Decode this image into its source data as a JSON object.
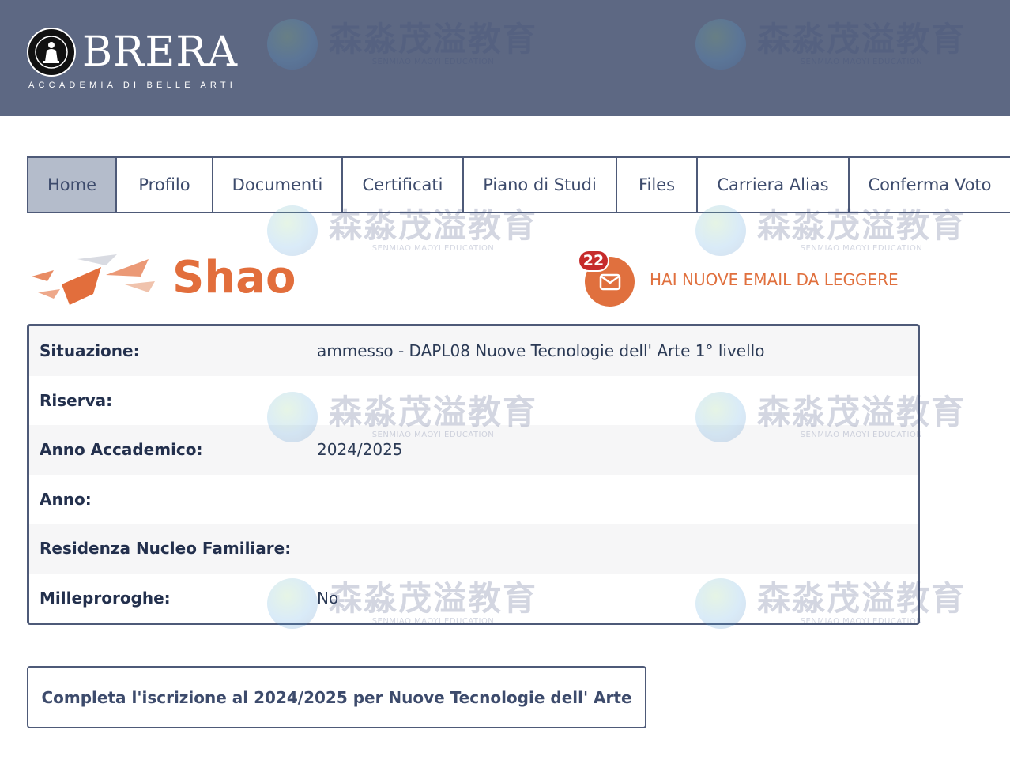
{
  "header": {
    "brand": "BRERA",
    "brand_sub": "ACCADEMIA DI BELLE ARTI"
  },
  "nav": {
    "tabs": [
      {
        "label": "Home",
        "active": true
      },
      {
        "label": "Profilo",
        "active": false
      },
      {
        "label": "Documenti",
        "active": false
      },
      {
        "label": "Certificati",
        "active": false
      },
      {
        "label": "Piano di Studi",
        "active": false
      },
      {
        "label": "Files",
        "active": false
      },
      {
        "label": "Carriera Alias",
        "active": false
      },
      {
        "label": "Conferma Voto",
        "active": false
      }
    ]
  },
  "user": {
    "name": "Shao"
  },
  "mail": {
    "count": "22",
    "text": "HAI NUOVE EMAIL DA LEGGERE",
    "icon": "envelope-icon"
  },
  "info": {
    "rows": [
      {
        "label": "Situazione:",
        "value": "ammesso - DAPL08 Nuove Tecnologie dell' Arte 1° livello"
      },
      {
        "label": "Riserva:",
        "value": ""
      },
      {
        "label": "Anno Accademico:",
        "value": "2024/2025"
      },
      {
        "label": "Anno:",
        "value": ""
      },
      {
        "label": "Residenza Nucleo Familiare:",
        "value": ""
      },
      {
        "label": "Milleproroghe:",
        "value": "No"
      }
    ]
  },
  "cta": {
    "label": "Completa l'iscrizione al 2024/2025 per Nuove Tecnologie dell' Arte"
  },
  "watermark": {
    "cn": "森淼茂溢教育",
    "en": "SENMIAO MAOYI EDUCATION"
  },
  "colors": {
    "header_bg": "#5d6883",
    "accent": "#e0703e",
    "badge": "#c62b2b",
    "nav_active": "#b4bccb",
    "border": "#4e5a78"
  }
}
